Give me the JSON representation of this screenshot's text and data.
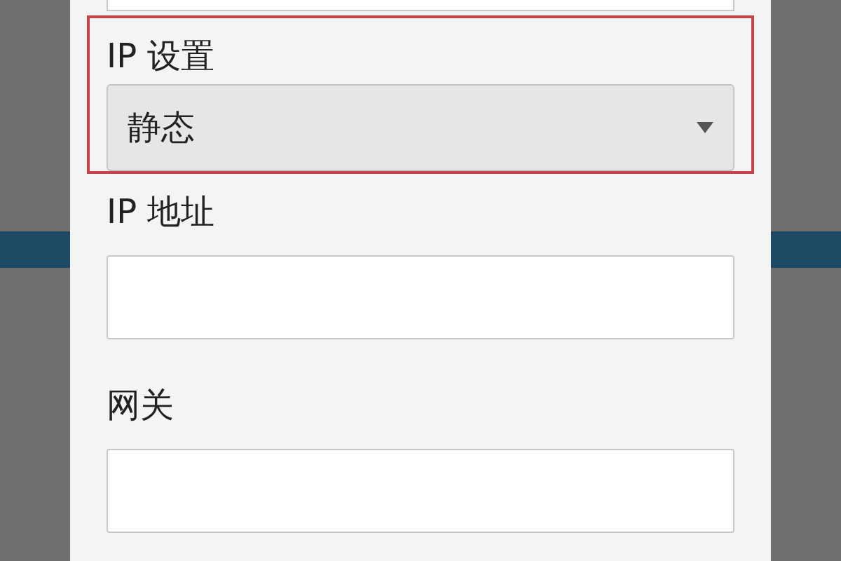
{
  "ip_settings": {
    "label": "IP 设置",
    "value": "静态"
  },
  "fields": [
    {
      "label": "IP 地址"
    },
    {
      "label": "网关"
    }
  ]
}
